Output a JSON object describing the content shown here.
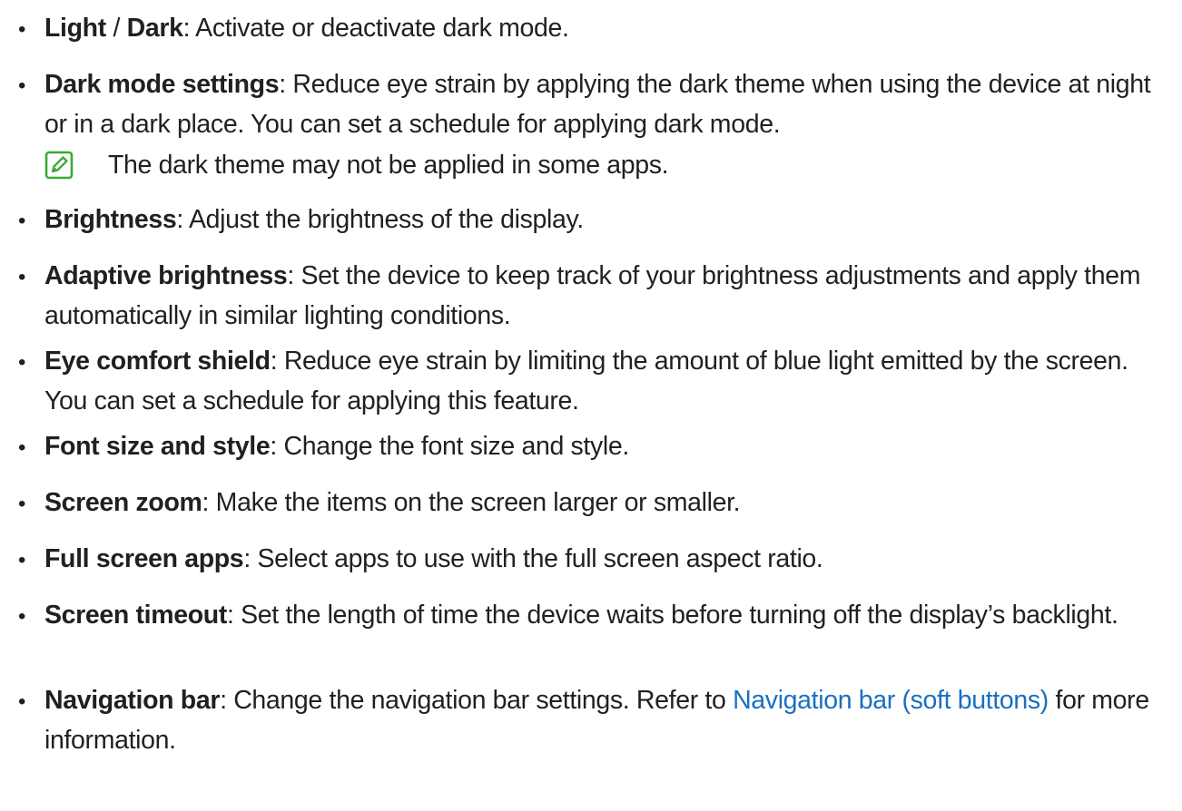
{
  "items": [
    {
      "term": "Light",
      "sep": " / ",
      "term2": "Dark",
      "desc": ": Activate or deactivate dark mode."
    },
    {
      "term": "Dark mode settings",
      "desc": ": Reduce eye strain by applying the dark theme when using the device at night or in a dark place. You can set a schedule for applying dark mode."
    },
    {
      "term": "Brightness",
      "desc": ": Adjust the brightness of the display."
    },
    {
      "term": "Adaptive brightness",
      "desc": ": Set the device to keep track of your brightness adjustments and apply them automatically in similar lighting conditions."
    },
    {
      "term": "Eye comfort shield",
      "desc": ": Reduce eye strain by limiting the amount of blue light emitted by the screen. You can set a schedule for applying this feature."
    },
    {
      "term": "Font size and style",
      "desc": ": Change the font size and style."
    },
    {
      "term": "Screen zoom",
      "desc": ": Make the items on the screen larger or smaller."
    },
    {
      "term": "Full screen apps",
      "desc": ": Select apps to use with the full screen aspect ratio."
    },
    {
      "term": "Screen timeout",
      "desc": ": Set the length of time the device waits before turning off the display’s backlight."
    },
    {
      "term": "Navigation bar",
      "desc": ": Change the navigation bar settings. Refer to ",
      "link": "Navigation bar (soft buttons)",
      "desc_after": " for more information."
    }
  ],
  "bullet_char": "•",
  "note": {
    "icon": "note-pen-icon",
    "text": "The dark theme may not be applied in some apps."
  },
  "colors": {
    "text": "#231f20",
    "link": "#1a6fc2",
    "note_icon": "#3aaa35"
  }
}
